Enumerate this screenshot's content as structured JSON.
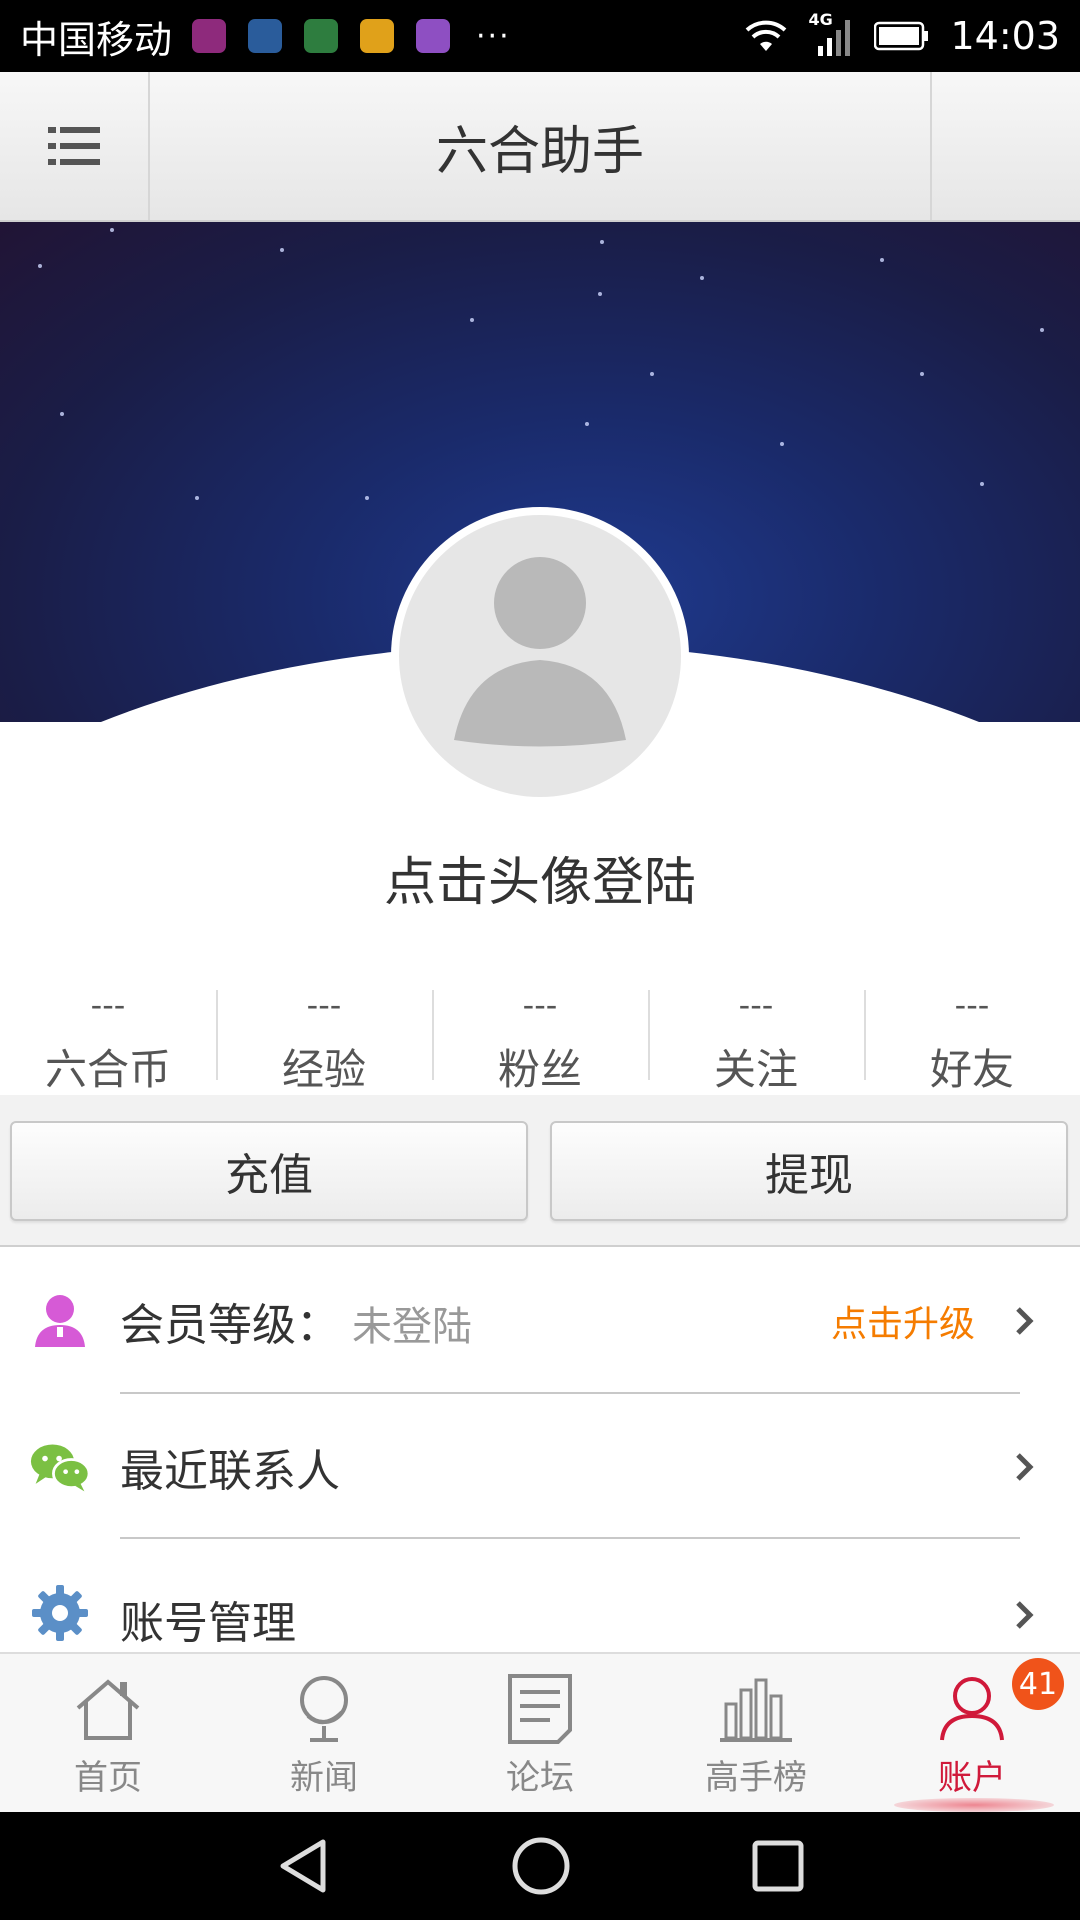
{
  "status_bar": {
    "carrier": "中国移动",
    "notification_icons": [
      {
        "name": "emui-icon",
        "color": "#8e2a7c"
      },
      {
        "name": "health-icon",
        "color": "#2a5c9b"
      },
      {
        "name": "message-icon",
        "color": "#2e7d3f"
      },
      {
        "name": "wallet-icon",
        "color": "#e0a11a"
      },
      {
        "name": "gallery-icon",
        "color": "#8e4fc2"
      }
    ],
    "more": "···",
    "network": "4G",
    "time": "14:03"
  },
  "top_bar": {
    "title": "六合助手"
  },
  "profile": {
    "login_prompt": "点击头像登陆"
  },
  "stats": [
    {
      "value": "---",
      "label": "六合币"
    },
    {
      "value": "---",
      "label": "经验"
    },
    {
      "value": "---",
      "label": "粉丝"
    },
    {
      "value": "---",
      "label": "关注"
    },
    {
      "value": "---",
      "label": "好友"
    }
  ],
  "actions": {
    "recharge": "充值",
    "withdraw": "提现"
  },
  "menu": {
    "membership": {
      "title": "会员等级：",
      "status": "未登陆",
      "action": "点击升级"
    },
    "recent_contacts": {
      "title": "最近联系人"
    },
    "account_manage": {
      "title": "账号管理"
    }
  },
  "bottom_nav": {
    "items": [
      {
        "label": "首页"
      },
      {
        "label": "新闻"
      },
      {
        "label": "论坛"
      },
      {
        "label": "高手榜"
      },
      {
        "label": "账户",
        "badge": "41"
      }
    ],
    "active_color": "#d0193a"
  },
  "colors": {
    "accent_orange": "#f57c00",
    "membership_icon": "#d65ad6",
    "wechat_icon": "#7bc043",
    "gear_icon": "#5b8fc7"
  }
}
